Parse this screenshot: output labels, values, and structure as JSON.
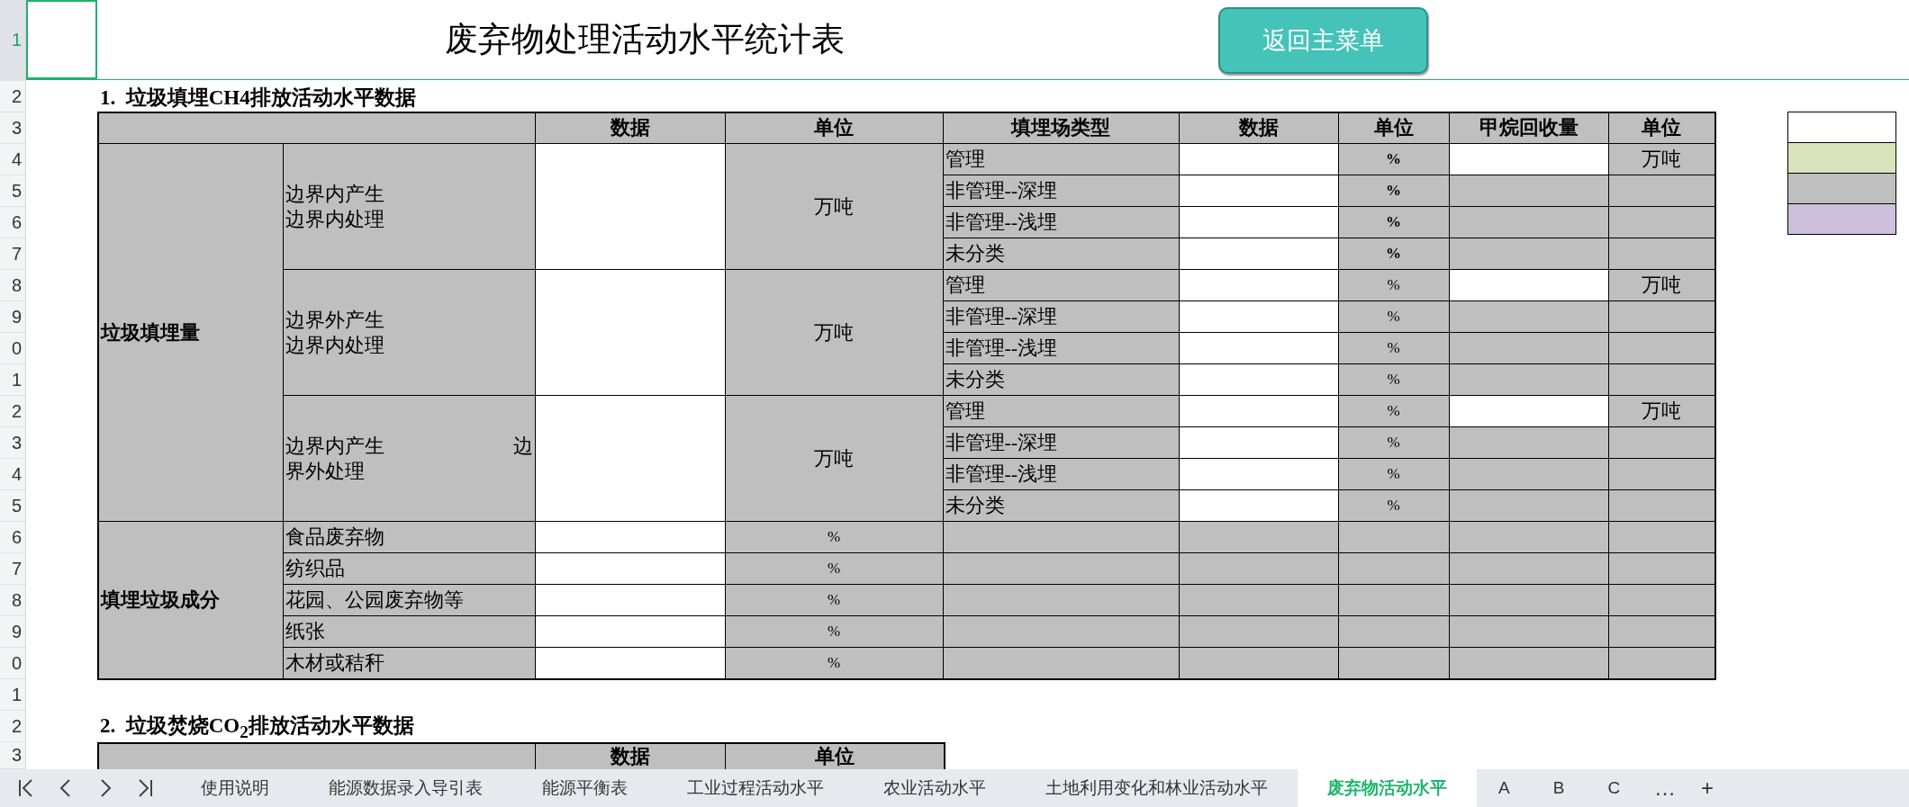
{
  "sheet": {
    "title": "废弃物处理活动水平统计表",
    "menu_button": "返回主菜单",
    "row_numbers": [
      {
        "label": "1",
        "selected": true
      },
      {
        "label": "2",
        "selected": false
      },
      {
        "label": "3",
        "selected": false
      },
      {
        "label": "4",
        "selected": false
      },
      {
        "label": "5",
        "selected": false
      },
      {
        "label": "6",
        "selected": false
      },
      {
        "label": "7",
        "selected": false
      },
      {
        "label": "8",
        "selected": false
      },
      {
        "label": "9",
        "selected": false
      },
      {
        "label": "0",
        "selected": false
      },
      {
        "label": "1",
        "selected": false
      },
      {
        "label": "2",
        "selected": false
      },
      {
        "label": "3",
        "selected": false
      },
      {
        "label": "4",
        "selected": false
      },
      {
        "label": "5",
        "selected": false
      },
      {
        "label": "6",
        "selected": false
      },
      {
        "label": "7",
        "selected": false
      },
      {
        "label": "8",
        "selected": false
      },
      {
        "label": "9",
        "selected": false
      },
      {
        "label": "0",
        "selected": false
      },
      {
        "label": "1",
        "selected": false
      },
      {
        "label": "2",
        "selected": false
      },
      {
        "label": "3",
        "selected": false
      }
    ]
  },
  "section_1": {
    "heading": "1.  垃圾填埋CH4排放活动水平数据",
    "columns": [
      "数据",
      "单位",
      "填埋场类型",
      "数据",
      "单位",
      "甲烷回收量",
      "单位"
    ],
    "landfill": {
      "label": "垃圾填埋量",
      "groups": [
        {
          "lines": [
            "边界内产生",
            "边界内处理"
          ],
          "unit": "万吨",
          "unit_bold": true,
          "rows": [
            {
              "type": "管理",
              "unit": "%",
              "recovery_unit": "万吨"
            },
            {
              "type": "非管理--深埋",
              "unit": "%"
            },
            {
              "type": "非管理--浅埋",
              "unit": "%"
            },
            {
              "type": "未分类",
              "unit": "%"
            }
          ]
        },
        {
          "lines": [
            "边界外产生",
            "边界内处理"
          ],
          "unit": "万吨",
          "unit_bold": false,
          "rows": [
            {
              "type": "管理",
              "unit": "%",
              "recovery_unit": "万吨"
            },
            {
              "type": "非管理--深埋",
              "unit": "%"
            },
            {
              "type": "非管理--浅埋",
              "unit": "%"
            },
            {
              "type": "未分类",
              "unit": "%"
            }
          ]
        },
        {
          "lines": [
            "边界内产生",
            "边",
            "界外处理"
          ],
          "unit": "万吨",
          "unit_bold": false,
          "rows": [
            {
              "type": "管理",
              "unit": "%",
              "recovery_unit": "万吨"
            },
            {
              "type": "非管理--深埋",
              "unit": "%"
            },
            {
              "type": "非管理--浅埋",
              "unit": "%"
            },
            {
              "type": "未分类",
              "unit": "%"
            }
          ]
        }
      ]
    },
    "composition": {
      "label": "填埋垃圾成分",
      "items": [
        {
          "name": "食品废弃物",
          "unit": "%"
        },
        {
          "name": "纺织品",
          "unit": "%"
        },
        {
          "name": "花园、公园废弃物等",
          "unit": "%"
        },
        {
          "name": "纸张",
          "unit": "%"
        },
        {
          "name": "木材或秸秆",
          "unit": "%"
        }
      ]
    }
  },
  "legend": [
    {
      "color": "#ffffff"
    },
    {
      "color": "#d8e4bc"
    },
    {
      "color": "#bfbfbf"
    },
    {
      "color": "#ccc0da"
    }
  ],
  "section_2": {
    "heading": "2.  垃圾焚烧CO$_{2}$排放活动水平数据",
    "columns": [
      "数据",
      "单位"
    ]
  },
  "sheet_tabs": [
    {
      "label": "使用说明",
      "selected": false
    },
    {
      "label": "能源数据录入导引表",
      "selected": false
    },
    {
      "label": "能源平衡表",
      "selected": false
    },
    {
      "label": "工业过程活动水平",
      "selected": false
    },
    {
      "label": "农业活动水平",
      "selected": false
    },
    {
      "label": "土地利用变化和林业活动水平",
      "selected": false
    },
    {
      "label": "废弃物活动水平",
      "selected": true
    },
    {
      "label": "A",
      "selected": false
    },
    {
      "label": "B",
      "selected": false
    },
    {
      "label": "C",
      "selected": false
    }
  ],
  "tab_extras": [
    "…",
    "+"
  ]
}
